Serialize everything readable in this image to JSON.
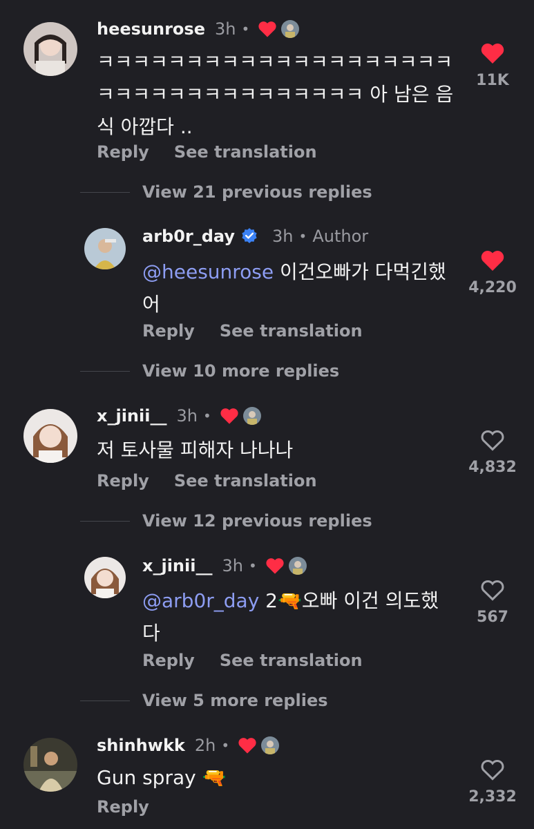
{
  "comments": [
    {
      "username": "heesunrose",
      "time": "3h",
      "dot": "•",
      "text": "ㅋㅋㅋㅋㅋㅋㅋㅋㅋㅋㅋㅋㅋㅋㅋㅋㅋㅋㅋㅋㅋㅋㅋㅋㅋㅋㅋㅋㅋㅋㅋㅋㅋㅋㅋ 아 남은 음식 아깝다 ..",
      "reply_label": "Reply",
      "translate_label": "See translation",
      "like_count": "11K",
      "liked": true
    },
    {
      "username": "arb0r_day",
      "time": "3h",
      "dot": "•",
      "author_label": "Author",
      "mention": "@heesunrose",
      "text": " 이건오빠가 다먹긴했어",
      "reply_label": "Reply",
      "translate_label": "See translation",
      "like_count": "4,220",
      "liked": true
    },
    {
      "username": "x_jinii__",
      "time": "3h",
      "dot": "•",
      "text": "저 토사물 피해자 나나나",
      "reply_label": "Reply",
      "translate_label": "See translation",
      "like_count": "4,832",
      "liked": false
    },
    {
      "username": "x_jinii__",
      "time": "3h",
      "dot": "•",
      "mention": "@arb0r_day",
      "text": " 2🔫오빠 이건 의도했다",
      "reply_label": "Reply",
      "translate_label": "See translation",
      "like_count": "567",
      "liked": false
    },
    {
      "username": "shinhwkk",
      "time": "2h",
      "dot": "•",
      "text": "Gun spray 🔫",
      "reply_label": "Reply",
      "like_count": "2,332",
      "liked": false
    }
  ],
  "view_more": [
    "View 21 previous replies",
    "View 10 more replies",
    "View 12 previous replies",
    "View 5 more replies"
  ],
  "colors": {
    "background": "#1f1f24",
    "heart_red": "#ff2d45",
    "mention_blue": "#8d9df2",
    "verified_blue": "#3b82f6"
  },
  "icons": [
    "heart-icon",
    "heart-outline-icon",
    "verified-badge-icon",
    "avatar"
  ]
}
